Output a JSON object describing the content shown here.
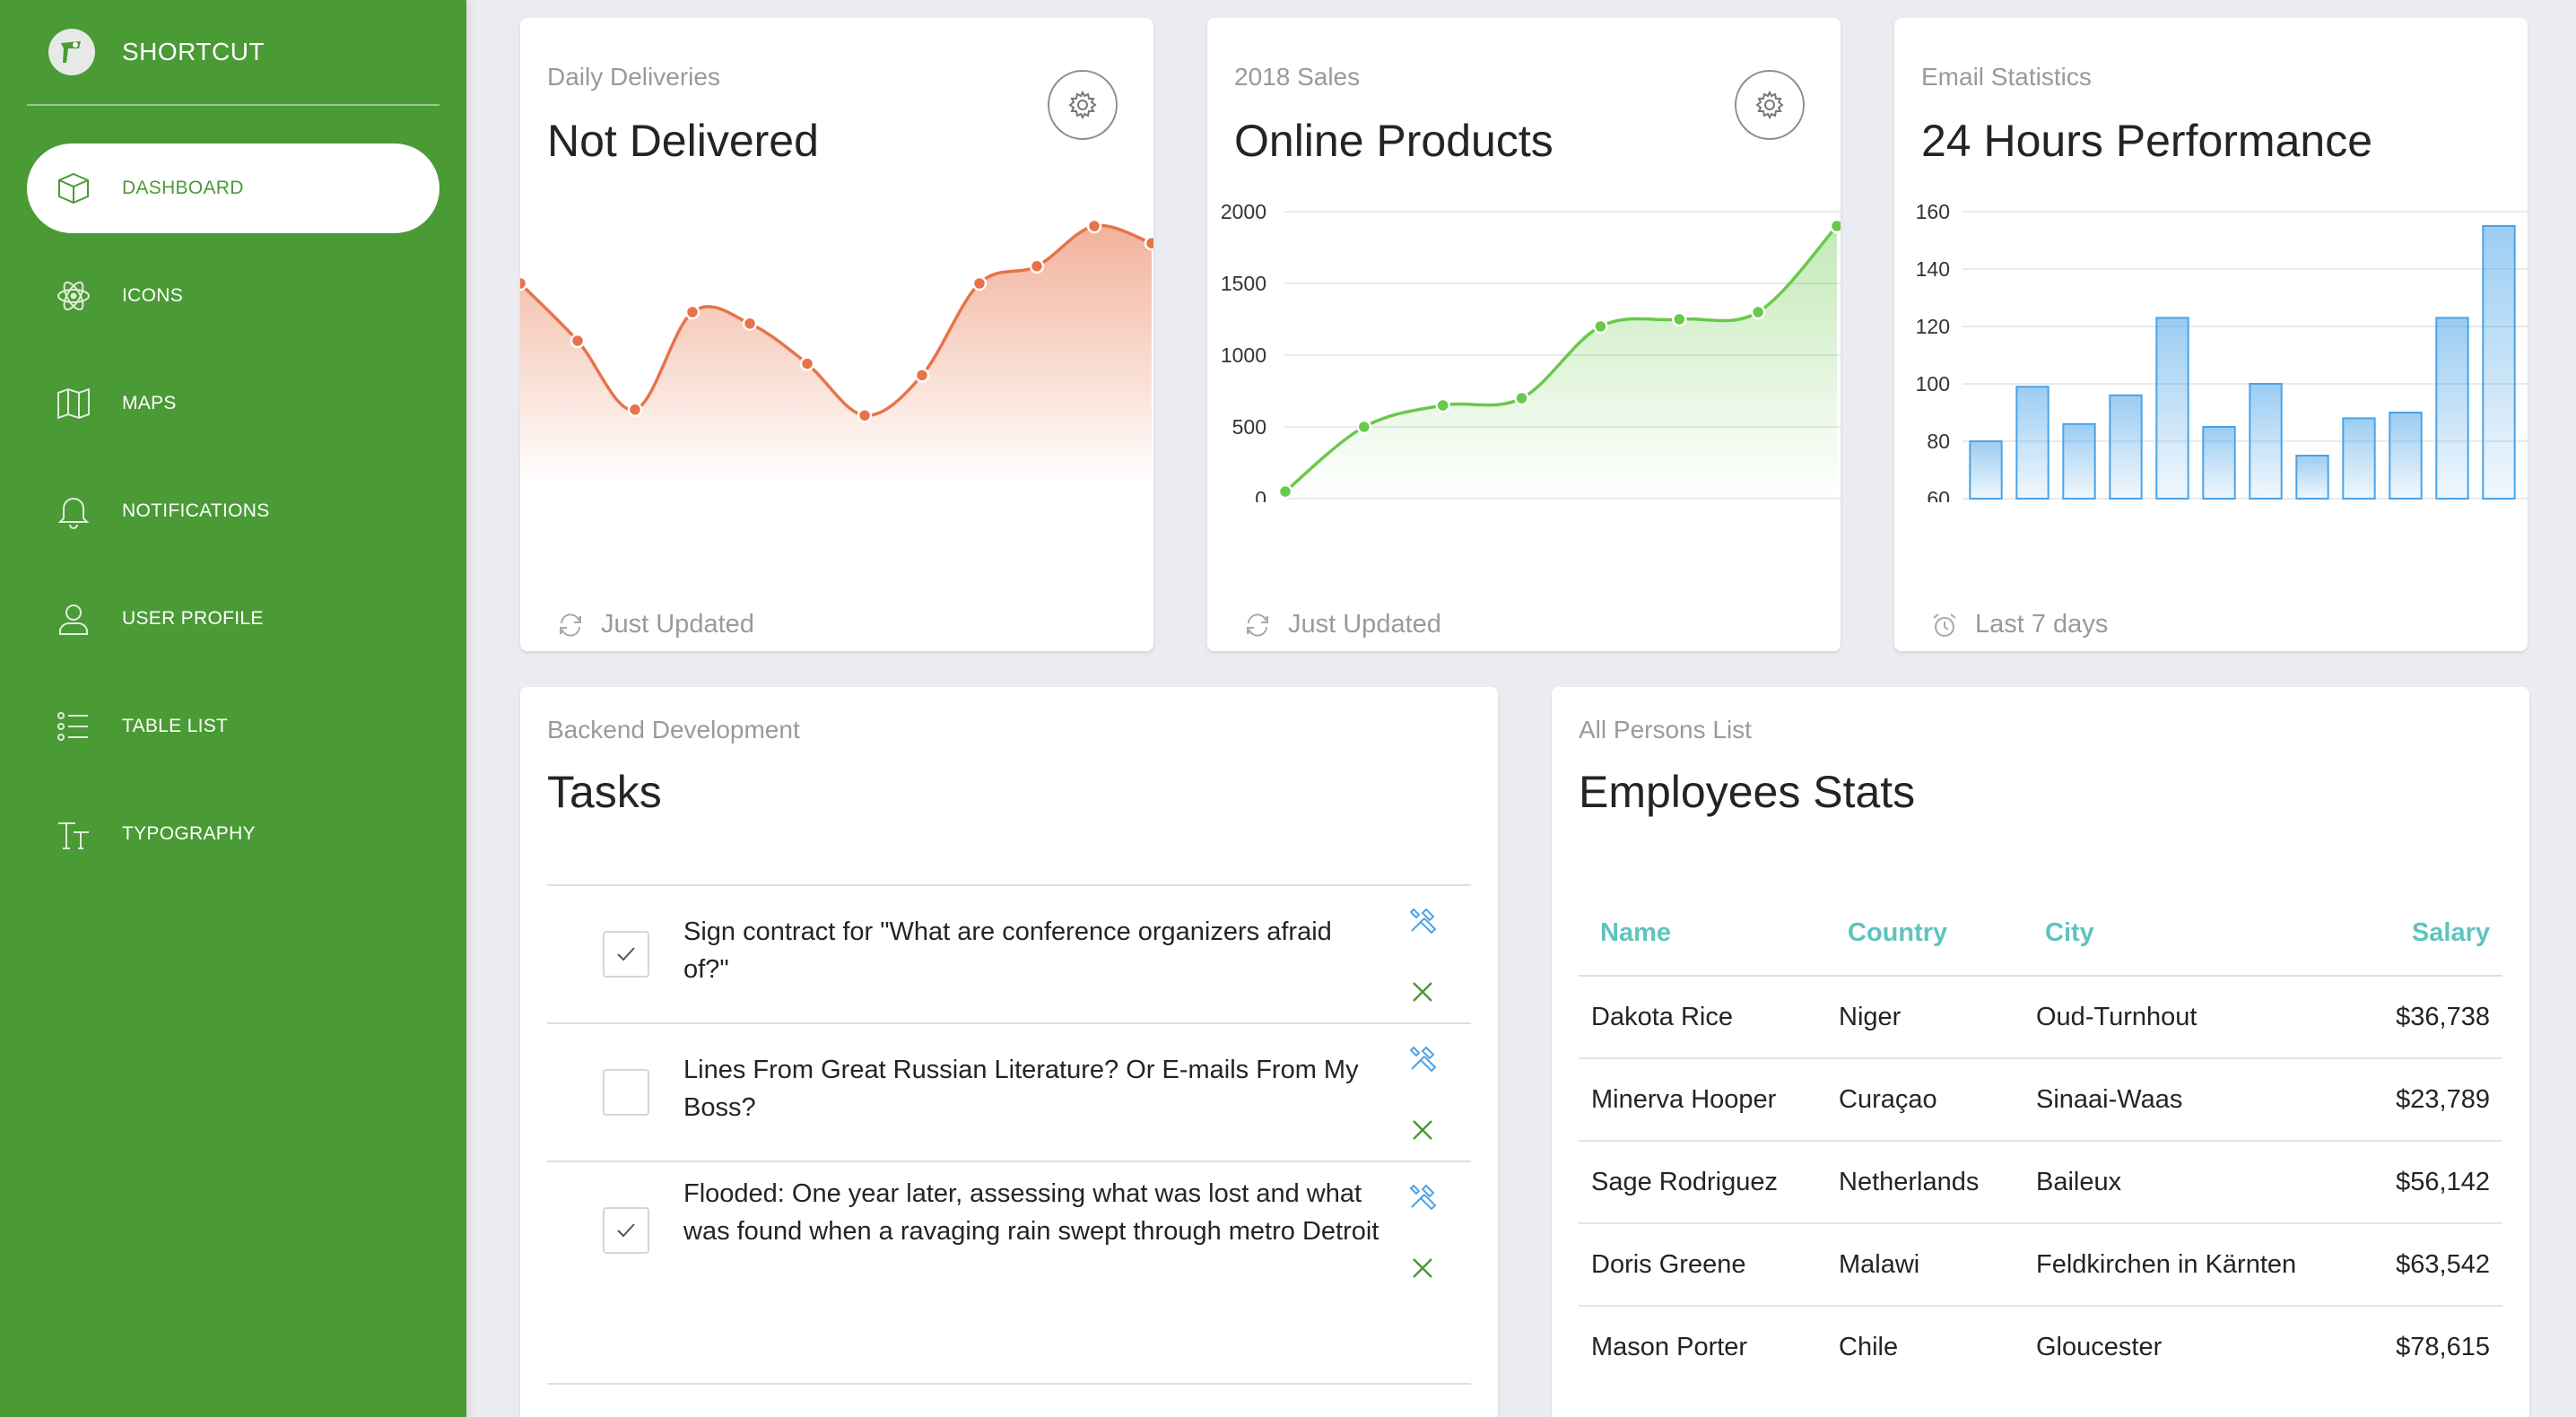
{
  "brand": {
    "name": "SHORTCUT"
  },
  "sidebar": {
    "items": [
      {
        "label": "DASHBOARD",
        "icon": "box-icon",
        "active": true
      },
      {
        "label": "ICONS",
        "icon": "atom-icon",
        "active": false
      },
      {
        "label": "MAPS",
        "icon": "map-icon",
        "active": false
      },
      {
        "label": "NOTIFICATIONS",
        "icon": "bell-icon",
        "active": false
      },
      {
        "label": "USER PROFILE",
        "icon": "user-icon",
        "active": false
      },
      {
        "label": "TABLE LIST",
        "icon": "list-icon",
        "active": false
      },
      {
        "label": "TYPOGRAPHY",
        "icon": "typography-icon",
        "active": false
      }
    ]
  },
  "colors": {
    "sidebar": "#4a9a36",
    "orange": "#e8734a",
    "green": "#69c94a",
    "blue": "#4aa3e8",
    "teal": "#5fc3be"
  },
  "cards": {
    "deliveries": {
      "category": "Daily Deliveries",
      "title": "Not Delivered",
      "footer": "Just Updated"
    },
    "sales": {
      "category": "2018 Sales",
      "title": "Online Products",
      "footer": "Just Updated"
    },
    "email": {
      "category": "Email Statistics",
      "title": "24 Hours Performance",
      "footer": "Last 7 days"
    }
  },
  "chart_data": [
    {
      "type": "area",
      "values": [
        35,
        25,
        13,
        30,
        28,
        21,
        12,
        19,
        35,
        38,
        45,
        42
      ],
      "ylim": [
        0,
        50
      ]
    },
    {
      "type": "area",
      "values": [
        50,
        500,
        650,
        700,
        1200,
        1250,
        1300,
        1900
      ],
      "yticks": [
        "0",
        "500",
        "1000",
        "1500",
        "2000"
      ],
      "ylim": [
        0,
        2000
      ]
    },
    {
      "type": "bar",
      "values": [
        80,
        99,
        86,
        96,
        123,
        85,
        100,
        75,
        88,
        90,
        123,
        155
      ],
      "yticks": [
        "60",
        "80",
        "100",
        "120",
        "140",
        "160"
      ],
      "ylim": [
        60,
        160
      ]
    }
  ],
  "tasks": {
    "category": "Backend Development",
    "title": "Tasks",
    "items": [
      {
        "text": "Sign contract for \"What are conference organizers afraid of?\"",
        "checked": true
      },
      {
        "text": "Lines From Great Russian Literature? Or E-mails From My Boss?",
        "checked": false
      },
      {
        "text": "Flooded: One year later, assessing what was lost and what was found when a ravaging rain swept through metro Detroit",
        "checked": true
      }
    ]
  },
  "employees": {
    "category": "All Persons List",
    "title": "Employees Stats",
    "headers": {
      "name": "Name",
      "country": "Country",
      "city": "City",
      "salary": "Salary"
    },
    "rows": [
      {
        "name": "Dakota Rice",
        "country": "Niger",
        "city": "Oud-Turnhout",
        "salary": "$36,738"
      },
      {
        "name": "Minerva Hooper",
        "country": "Curaçao",
        "city": "Sinaai-Waas",
        "salary": "$23,789"
      },
      {
        "name": "Sage Rodriguez",
        "country": "Netherlands",
        "city": "Baileux",
        "salary": "$56,142"
      },
      {
        "name": "Doris Greene",
        "country": "Malawi",
        "city": "Feldkirchen in Kärnten",
        "salary": "$63,542"
      },
      {
        "name": "Mason Porter",
        "country": "Chile",
        "city": "Gloucester",
        "salary": "$78,615"
      }
    ]
  }
}
